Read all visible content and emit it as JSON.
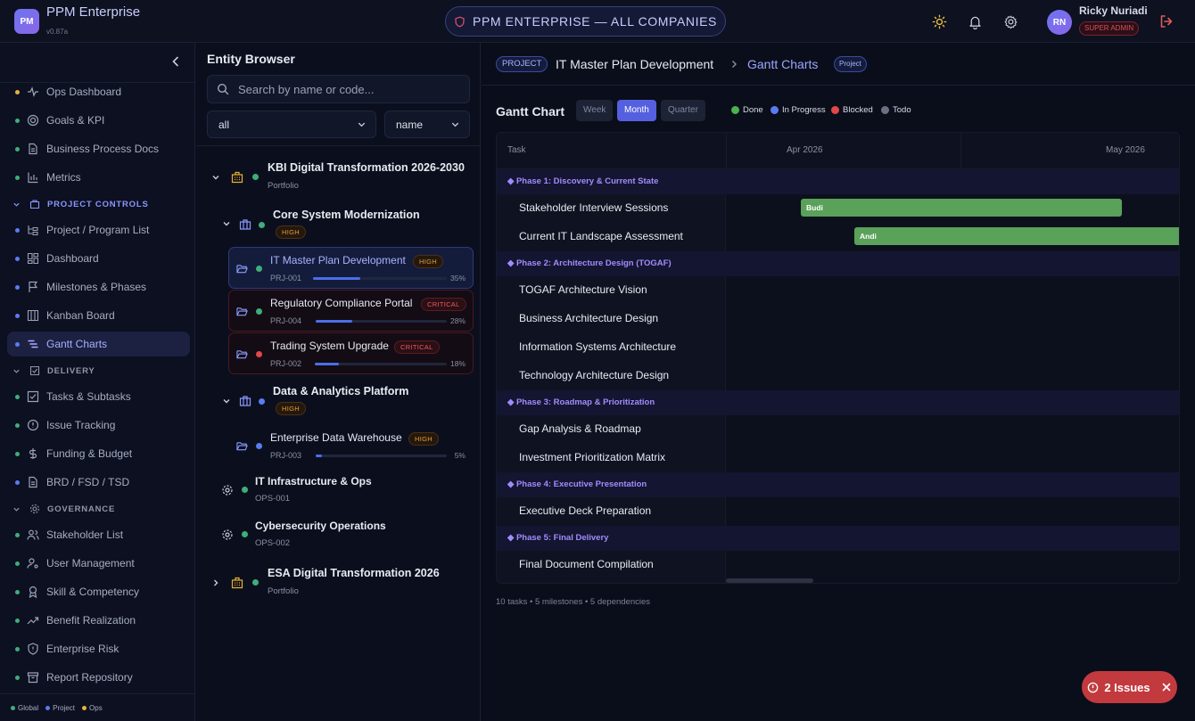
{
  "app": {
    "logo": "PM",
    "name": "PPM Enterprise",
    "version": "v0.87a"
  },
  "topbar": {
    "scope_label": "PPM ENTERPRISE — ALL COMPANIES",
    "icons": [
      "sun-icon",
      "bell-icon",
      "gear-icon"
    ],
    "user": {
      "initials": "RN",
      "name": "Ricky Nuriadi",
      "role": "SUPER ADMIN"
    }
  },
  "sidebar": {
    "items_top": [
      {
        "label": "Ops Dashboard",
        "dot": "#e2b340",
        "icon": "activity-icon"
      },
      {
        "label": "Goals & KPI",
        "dot": "#3fae7a",
        "icon": "target-icon"
      },
      {
        "label": "Business Process Docs",
        "dot": "#3fae7a",
        "icon": "document-icon"
      },
      {
        "label": "Metrics",
        "dot": "#3fae7a",
        "icon": "bar-chart-icon"
      }
    ],
    "section_project": "PROJECT CONTROLS",
    "items_project": [
      {
        "label": "Project / Program List",
        "dot": "#5b7cf0"
      },
      {
        "label": "Dashboard",
        "dot": "#5b7cf0"
      },
      {
        "label": "Milestones & Phases",
        "dot": "#5b7cf0"
      },
      {
        "label": "Kanban Board",
        "dot": "#5b7cf0"
      },
      {
        "label": "Gantt Charts",
        "dot": "#5b7cf0"
      }
    ],
    "section_delivery": "DELIVERY",
    "items_delivery": [
      {
        "label": "Tasks & Subtasks",
        "dot": "#3fae7a"
      },
      {
        "label": "Issue Tracking",
        "dot": "#3fae7a"
      },
      {
        "label": "Funding & Budget",
        "dot": "#3fae7a"
      },
      {
        "label": "BRD / FSD / TSD",
        "dot": "#5b7cf0"
      }
    ],
    "section_governance": "GOVERNANCE",
    "items_governance": [
      {
        "label": "Stakeholder List",
        "dot": "#3fae7a"
      },
      {
        "label": "User Management",
        "dot": "#3fae7a"
      },
      {
        "label": "Skill & Competency",
        "dot": "#3fae7a"
      },
      {
        "label": "Benefit Realization",
        "dot": "#3fae7a"
      },
      {
        "label": "Enterprise Risk",
        "dot": "#3fae7a"
      },
      {
        "label": "Report Repository",
        "dot": "#3fae7a"
      }
    ],
    "legend": [
      {
        "label": "Global",
        "color": "#3fae7a"
      },
      {
        "label": "Project",
        "color": "#5b7cf0"
      },
      {
        "label": "Ops",
        "color": "#e2b340"
      }
    ]
  },
  "browser": {
    "title": "Entity Browser",
    "search_placeholder": "Search by name or code...",
    "filter_value": "all",
    "sort_value": "name",
    "tree": {
      "portfolio1": {
        "name": "KBI Digital Transformation 2026-2030",
        "type": "Portfolio"
      },
      "program1": {
        "name": "Core System Modernization",
        "badge": "HIGH"
      },
      "projects1": [
        {
          "name": "IT Master Plan Development",
          "badge": "HIGH",
          "code": "PRJ-001",
          "progress": 35,
          "pct": "35%"
        },
        {
          "name": "Regulatory Compliance Portal",
          "badge": "CRITICAL",
          "code": "PRJ-004",
          "progress": 28,
          "pct": "28%"
        },
        {
          "name": "Trading System Upgrade",
          "badge": "CRITICAL",
          "code": "PRJ-002",
          "progress": 18,
          "pct": "18%"
        }
      ],
      "program2": {
        "name": "Data & Analytics Platform",
        "badge": "HIGH"
      },
      "projects2": [
        {
          "name": "Enterprise Data Warehouse",
          "badge": "HIGH",
          "code": "PRJ-003",
          "progress": 5,
          "pct": "5%"
        }
      ],
      "ops": [
        {
          "name": "IT Infrastructure & Ops",
          "code": "OPS-001"
        },
        {
          "name": "Cybersecurity Operations",
          "code": "OPS-002"
        }
      ],
      "portfolio2": {
        "name": "ESA Digital Transformation 2026",
        "type": "Portfolio"
      }
    }
  },
  "main": {
    "breadcrumb": {
      "type": "PROJECT",
      "project": "IT Master Plan Development",
      "current": "Gantt Charts",
      "tag": "Project"
    },
    "gantt": {
      "title": "Gantt Chart",
      "zoom": [
        "Week",
        "Month",
        "Quarter"
      ],
      "zoom_selected": "Month",
      "legend": [
        {
          "label": "Done",
          "color": "#4caf50"
        },
        {
          "label": "In Progress",
          "color": "#5b7cf0"
        },
        {
          "label": "Blocked",
          "color": "#e04848"
        },
        {
          "label": "Todo",
          "color": "#6b7080"
        }
      ],
      "task_header": "Task",
      "months": [
        "Apr 2026",
        "May 2026"
      ],
      "rows": [
        {
          "kind": "phase",
          "label": "◆ Phase 1: Discovery & Current State"
        },
        {
          "kind": "task",
          "label": "Stakeholder Interview Sessions",
          "assignee": "Budi",
          "status": "Done",
          "start": "2026-04-01",
          "end": "2026-04-30"
        },
        {
          "kind": "task",
          "label": "Current IT Landscape Assessment",
          "assignee": "Andi",
          "status": "Done",
          "start": "2026-04-06",
          "end": "2026-05-15"
        },
        {
          "kind": "phase",
          "label": "◆ Phase 2: Architecture Design (TOGAF)"
        },
        {
          "kind": "task",
          "label": "TOGAF Architecture Vision"
        },
        {
          "kind": "task",
          "label": "Business Architecture Design"
        },
        {
          "kind": "task",
          "label": "Information Systems Architecture"
        },
        {
          "kind": "task",
          "label": "Technology Architecture Design"
        },
        {
          "kind": "phase",
          "label": "◆ Phase 3: Roadmap & Prioritization"
        },
        {
          "kind": "task",
          "label": "Gap Analysis & Roadmap"
        },
        {
          "kind": "task",
          "label": "Investment Prioritization Matrix"
        },
        {
          "kind": "phase",
          "label": "◆ Phase 4: Executive Presentation"
        },
        {
          "kind": "task",
          "label": "Executive Deck Preparation"
        },
        {
          "kind": "phase",
          "label": "◆ Phase 5: Final Delivery"
        },
        {
          "kind": "task",
          "label": "Final Document Compilation"
        }
      ],
      "footer": "10 tasks • 5 milestones • 5 dependencies"
    }
  },
  "issues": {
    "label": "2 Issues"
  }
}
